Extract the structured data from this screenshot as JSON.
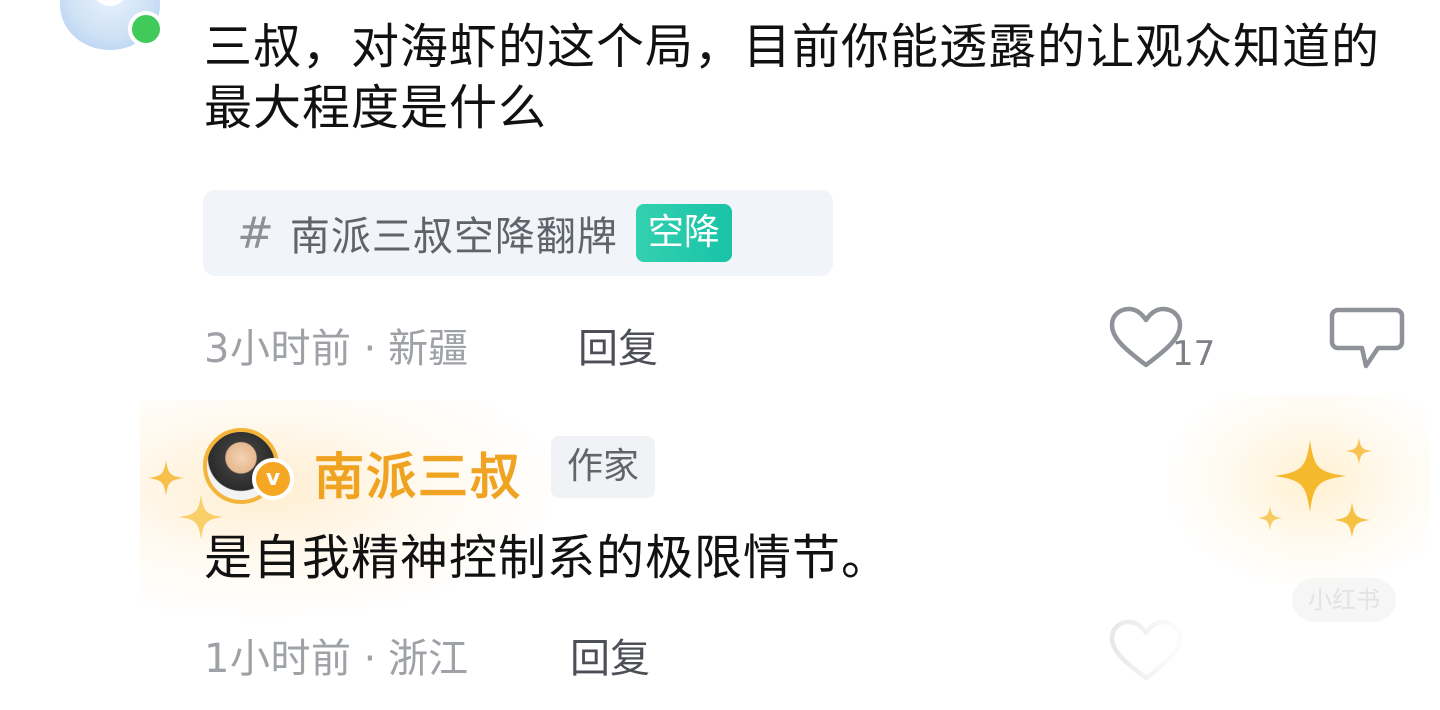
{
  "comments": [
    {
      "text": "三叔，对海虾的这个局，目前你能透露的让观众知道的最大程度是什么",
      "topic": {
        "hash": "#",
        "name": "南派三叔空降翻牌",
        "badge": "空降"
      },
      "time": "3小时前",
      "separator": "·",
      "location": "新疆",
      "reply_label": "回复",
      "likes": "17"
    }
  ],
  "reply": {
    "author": "南派三叔",
    "author_tag": "作家",
    "verified_mark": "v",
    "text": "是自我精神控制系的极限情节。",
    "time": "1小时前",
    "separator": "·",
    "location": "浙江",
    "reply_label": "回复"
  },
  "watermark": "小红书",
  "icons": {
    "like": "heart-outline-icon",
    "comment": "comment-bubble-icon",
    "sparkle": "sparkle-icon",
    "verified": "verified-badge-icon"
  },
  "colors": {
    "author_name": "#f0a321",
    "topic_badge": "#19c3a7",
    "online_dot": "#41c95a",
    "meta_text": "#9ea1a6"
  }
}
